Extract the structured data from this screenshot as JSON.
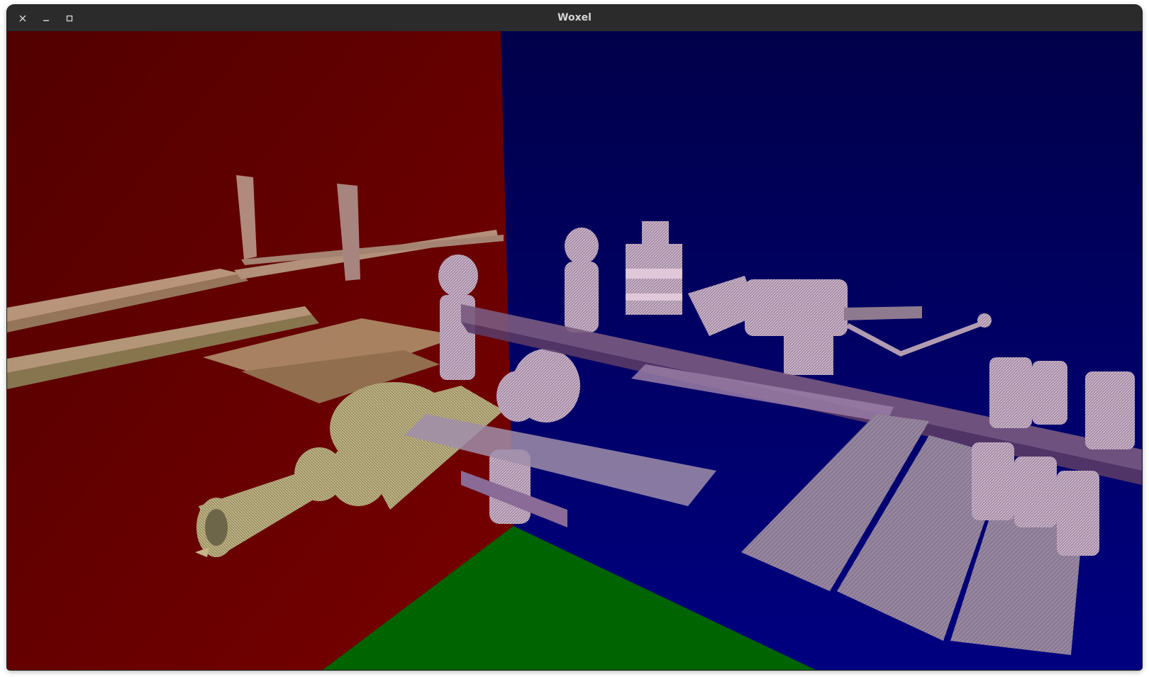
{
  "window": {
    "title": "Woxel",
    "controls": [
      "close-icon",
      "minimize-icon",
      "maximize-icon"
    ]
  },
  "scene": {
    "description_icons": [
      "iss-model",
      "voxel-render"
    ],
    "colors": {
      "titlebar": "#2b2b2b",
      "left_wall": "#6e0000",
      "back_wall": "#00006e",
      "floor": "#006400",
      "model_tint_left": "#a0966a",
      "model_tint_right": "#b49ab4"
    }
  }
}
